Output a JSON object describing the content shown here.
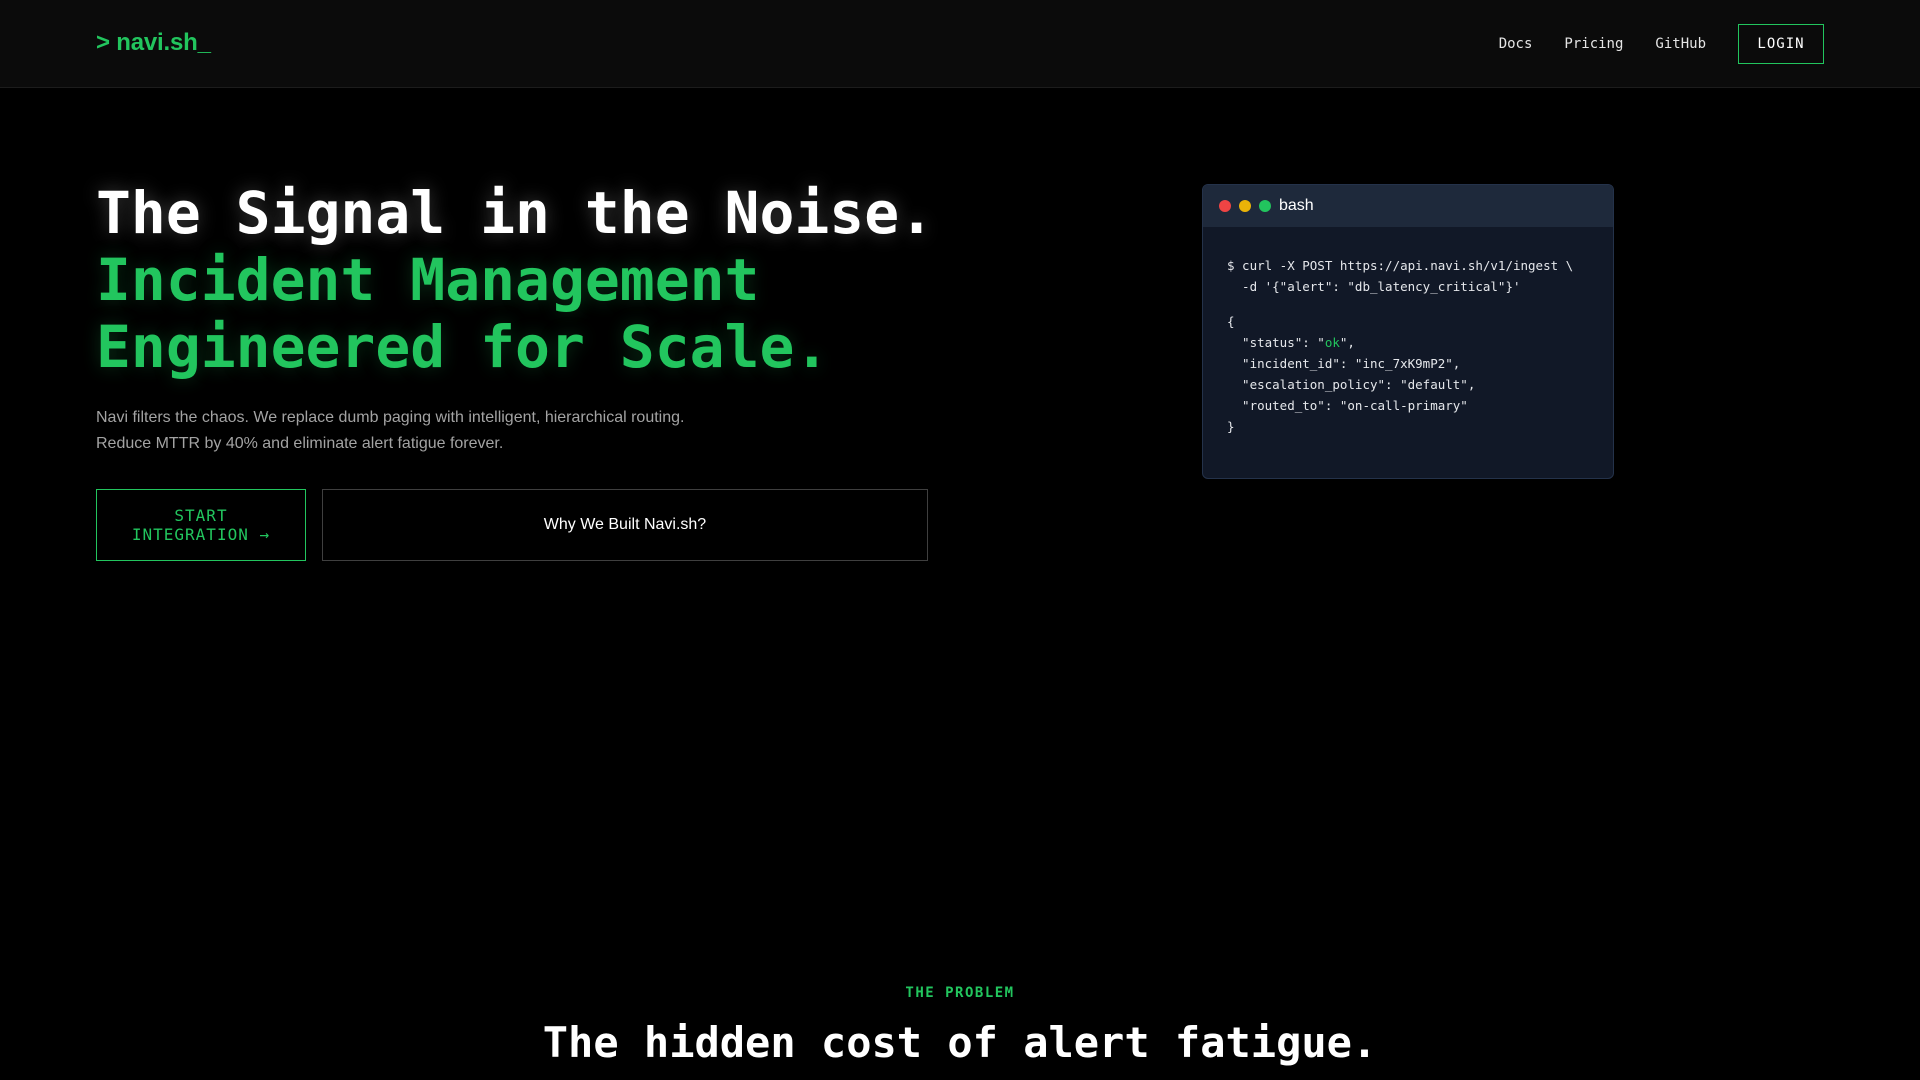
{
  "header": {
    "logo": "> navi.sh_",
    "nav": [
      {
        "label": "Docs"
      },
      {
        "label": "Pricing"
      },
      {
        "label": "GitHub"
      }
    ],
    "login_label": "LOGIN"
  },
  "hero": {
    "title_line1": "The Signal in the Noise.",
    "title_line2": "Incident Management",
    "title_line3": "Engineered for Scale.",
    "subtitle_line1": "Navi filters the chaos. We replace dumb paging with intelligent, hierarchical routing.",
    "subtitle_line2": "Reduce MTTR by 40% and eliminate alert fatigue forever.",
    "cta_primary": "START INTEGRATION →",
    "cta_secondary": "Why We Built Navi.sh?"
  },
  "terminal": {
    "title": "bash",
    "command_line1": "$ curl -X POST https://api.navi.sh/v1/ingest \\",
    "command_line2": "  -d '{\"alert\": \"db_latency_critical\"}'",
    "response_open": "{",
    "status_prefix": "  \"status\": \"",
    "status_value": "ok",
    "status_suffix": "\",",
    "incident_line": "  \"incident_id\": \"inc_7xK9mP2\",",
    "escalation_line": "  \"escalation_policy\": \"default\",",
    "routed_line": "  \"routed_to\": \"on-call-primary\"",
    "response_close": "}"
  },
  "problem": {
    "label": "THE PROBLEM",
    "title": "The hidden cost of alert fatigue."
  },
  "colors": {
    "accent": "#22c55e",
    "background": "#000000",
    "header_bg": "#0b0b0b",
    "terminal_bg": "#111827",
    "terminal_bar": "#1e293b"
  }
}
